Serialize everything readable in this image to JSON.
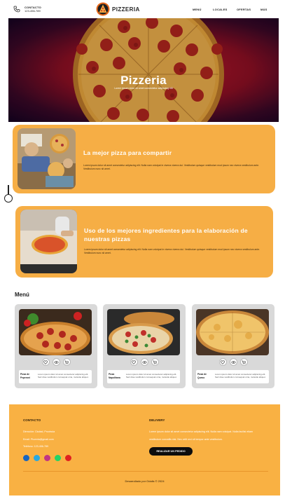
{
  "header": {
    "contact_label": "CONTACTO",
    "contact_phone": "123-456-789",
    "brand": "PIZZERIA",
    "nav": [
      "MENÚ",
      "LOCALES",
      "OFERTAS",
      "MÁS"
    ]
  },
  "hero": {
    "title": "Pizzeria",
    "subtitle": "Lorem ipsum dolor sit amet consectetur adipiscing elit"
  },
  "features": [
    {
      "title": "La mejor pizza para compartir",
      "text": "Lorem ipsum dolor sit amet consectetur adipiscing elit. Nulla nam volutpat in viverra viverra dui. Vestibulum quisque vestibulum mod ipsum nec viverra vestibulum ante. Vestibulum nunc sit amet."
    },
    {
      "title": "Uso de los mejores ingredientes para la elaboración de nuestras pizzas",
      "text": "Lorem ipsum dolor sit amet consectetur adipiscing elit. Nulla nam volutpat in viverra viverra dui. Vestibulum quisque vestibulum mod ipsum nec viverra vestibulum ante. Vestibulum nunc sit amet."
    }
  ],
  "menu": {
    "heading": "Menú",
    "items": [
      {
        "name": "Pizza de Peperoni",
        "desc": "Lorem ipsum dolor sit amet consectetur adipiscing elit. Sed vitae vestibulum consequat urna, molestie aliquet."
      },
      {
        "name": "Pizza Napolitana",
        "desc": "Lorem ipsum dolor sit amet consectetur adipiscing elit. Sed vitae vestibulum consequat urna, molestie aliquet."
      },
      {
        "name": "Pizza de Queso",
        "desc": "Lorem ipsum dolor sit amet consectetur adipiscing elit. Sed vitae vestibulum consequat urna, molestie aliquet."
      }
    ],
    "icons": [
      "heart-icon",
      "eye-icon",
      "cart-icon"
    ]
  },
  "footer": {
    "contact_heading": "CONTACTO",
    "address": "Dirección: Ciudad, Provincia",
    "email": "Email: Pizzeria@gmail.com",
    "phone": "Teléfono: 123-456-789",
    "delivery_heading": "DELIVERY",
    "delivery_text_1": "Lorem ipsum dolor sit amet consectetur adipiscing elit. Nulla nam volutpat. Nulla facilisi etiam",
    "delivery_text_2": "vestibulum convallis nisi. Nec velit orci sit tempor ante vestibulum.",
    "order_button": "REALIZAR UN PEDIDO",
    "social_colors": [
      "#1565c0",
      "#29a8e0",
      "#c13584",
      "#25d366",
      "#e02020"
    ],
    "copyright": "Desarrollado por Odalis © 2024"
  },
  "colors": {
    "accent": "#f6ae45",
    "footer_bg": "#f9b143",
    "card_bg": "#d9d9d9"
  }
}
